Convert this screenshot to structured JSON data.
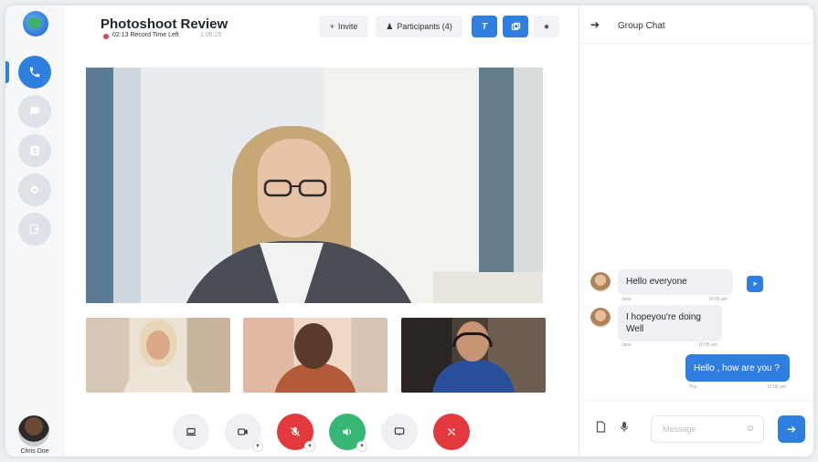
{
  "app": {
    "title": "Photoshoot Review",
    "record_label": "02:13 Record Time Left",
    "record_total": "1:05:25"
  },
  "header": {
    "invite_label": "Invite",
    "participants_label": "Participants (4)"
  },
  "sidebar": {
    "user_name": "Chris Doe",
    "items": [
      {
        "icon": "phone-icon",
        "active": true
      },
      {
        "icon": "chat-icon",
        "active": false
      },
      {
        "icon": "contact-icon",
        "active": false
      },
      {
        "icon": "settings-icon",
        "active": false
      },
      {
        "icon": "logout-icon",
        "active": false
      }
    ]
  },
  "chat": {
    "title": "Group Chat",
    "messages": [
      {
        "direction": "in",
        "text": "Hello everyone",
        "sender": "Jane",
        "time": "10:00 am"
      },
      {
        "direction": "in",
        "text": "I hopeyou're doing Well",
        "sender": "Jane",
        "time": "10:05 am"
      },
      {
        "direction": "out",
        "text": "Hello , how are you ?",
        "sender": "You",
        "time": "10:06 am"
      }
    ],
    "input_placeholder": "Message"
  },
  "controls": [
    "screen-share",
    "camera",
    "mute-mic",
    "speaker",
    "chat",
    "end-call"
  ],
  "colors": {
    "accent": "#2f7fe0",
    "danger": "#e4383f",
    "success": "#36b874"
  }
}
